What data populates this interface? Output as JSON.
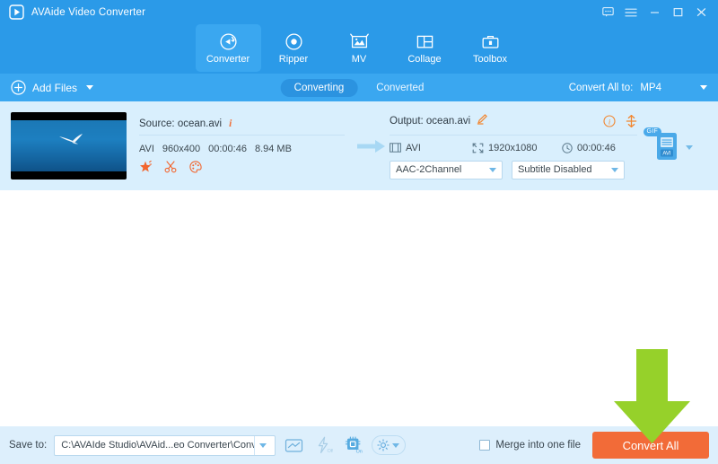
{
  "window": {
    "title": "AVAide Video Converter",
    "logo_icon": "play-triangle-logo",
    "controls": [
      {
        "name": "feedback-icon",
        "glyph": "feedback"
      },
      {
        "name": "menu-icon",
        "glyph": "hamburger"
      },
      {
        "name": "minimize-icon",
        "glyph": "minimize"
      },
      {
        "name": "maximize-icon",
        "glyph": "maximize"
      },
      {
        "name": "close-icon",
        "glyph": "close"
      }
    ]
  },
  "nav": {
    "tabs": [
      {
        "label": "Converter",
        "icon": "converter-icon",
        "active": true
      },
      {
        "label": "Ripper",
        "icon": "ripper-icon",
        "active": false
      },
      {
        "label": "MV",
        "icon": "mv-icon",
        "active": false
      },
      {
        "label": "Collage",
        "icon": "collage-icon",
        "active": false
      },
      {
        "label": "Toolbox",
        "icon": "toolbox-icon",
        "active": false
      }
    ]
  },
  "toolbar": {
    "add_files_label": "Add Files",
    "add_files_icon": "plus-circle-icon",
    "segments": [
      {
        "label": "Converting",
        "active": true
      },
      {
        "label": "Converted",
        "active": false
      }
    ],
    "convert_all_to_label": "Convert All to:",
    "convert_all_to_value": "MP4"
  },
  "file_item": {
    "thumbnail_alt": "ocean video thumbnail",
    "source": {
      "label": "Source: ocean.avi",
      "info_icon": "info-italic-icon",
      "format": "AVI",
      "resolution": "960x400",
      "duration": "00:00:46",
      "size": "8.94 MB",
      "tools": [
        {
          "name": "enhance-icon",
          "title": "Enhance"
        },
        {
          "name": "trim-scissors-icon",
          "title": "Trim"
        },
        {
          "name": "edit-palette-icon",
          "title": "Edit"
        }
      ]
    },
    "arrow_icon": "right-arrow-icon",
    "output": {
      "label": "Output: ocean.avi",
      "edit_icon": "pencil-edit-icon",
      "info_icon": "info-circle-icon",
      "merge_icon": "merge-split-icon",
      "format": "AVI",
      "format_icon": "film-strip-icon",
      "resolution": "1920x1080",
      "resolution_icon": "resize-icon",
      "duration": "00:00:46",
      "duration_icon": "clock-icon",
      "audio_select": "AAC-2Channel",
      "subtitle_select": "Subtitle Disabled"
    },
    "format_badge": {
      "tag": "GIF",
      "icon": "format-file-icon",
      "caret_icon": "chevron-down-icon"
    }
  },
  "bottom": {
    "save_to_label": "Save to:",
    "save_path": "C:\\AVAIde Studio\\AVAid...eo Converter\\Converted",
    "path_caret_icon": "chevron-down-icon",
    "icons": [
      {
        "name": "open-folder-icon",
        "state": ""
      },
      {
        "name": "lightning-icon",
        "state": "Off"
      },
      {
        "name": "gpu-chip-icon",
        "state": "On"
      }
    ],
    "gear_icon": "gear-icon",
    "gear_caret_icon": "chevron-down-icon",
    "merge_label": "Merge into one file",
    "merge_checked": false,
    "convert_button_label": "Convert All"
  },
  "annotation": {
    "arrow_icon": "green-down-arrow",
    "color": "#96d12a",
    "points_at": "convert-all-button"
  },
  "colors": {
    "titlebar": "#2b9ae8",
    "nav": "#2b9ae8",
    "toolbar": "#3aa7f0",
    "card": "#d9effd",
    "bottombar": "#ddeffc",
    "accent_orange": "#f26b38",
    "annotation_green": "#96d12a"
  }
}
